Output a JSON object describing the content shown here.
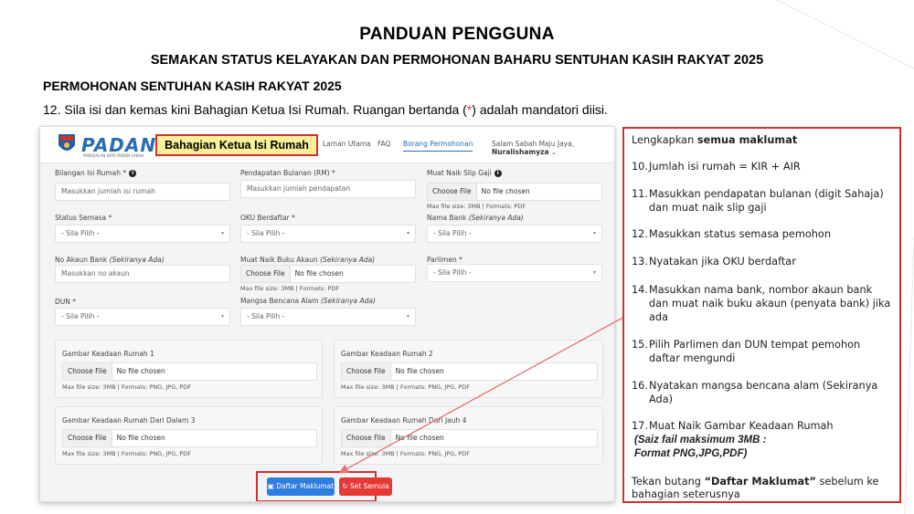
{
  "slide": {
    "title": "PANDUAN PENGGUNA",
    "subtitle": "SEMAKAN STATUS KELAYAKAN DAN PERMOHONAN BAHARU SENTUHAN  KASIH RAKYAT 2025",
    "section": "PERMOHONAN SENTUHAN  KASIH RAKYAT 2025",
    "instruction_pre": "12. Sila isi dan kemas kini Bahagian Ketua Isi Rumah. Ruangan bertanda (",
    "instruction_star": "*",
    "instruction_post": ") adalah mandatori diisi."
  },
  "app": {
    "brand": "PADANS",
    "brand_tagline": "PANGKALAN DATA MISKIN SABAH",
    "section_label": "Bahagian Ketua Isi Rumah",
    "nav": [
      "Laman Utama",
      "FAQ",
      "Borang Permohonan",
      "Salam Sabah Maju Jaya,"
    ],
    "username": "Nuralishamyza",
    "user_caret": "⌄"
  },
  "form": {
    "info_glyph": "i",
    "select_caret": "▾",
    "bilangan": {
      "label": "Bilangan Isi Rumah *",
      "placeholder": "Masukkan jumlah isi rumah"
    },
    "pendapatan": {
      "label": "Pendapatan Bulanan (RM) *",
      "placeholder": "Masukkan jumlah pendapatan"
    },
    "slip": {
      "label": "Muat Naik Slip Gaji",
      "choose": "Choose File",
      "nofile": "No file chosen",
      "hint": "Max file size: 3MB | Formats: PDF"
    },
    "status": {
      "label": "Status Semasa *",
      "value": "- Sila Pilih -"
    },
    "oku": {
      "label": "OKU Berdaftar *",
      "value": "- Sila Pilih -"
    },
    "bank": {
      "label": "Nama Bank",
      "label_opt": "(Sekiranya Ada)",
      "value": "- Sila Pilih -"
    },
    "akaun": {
      "label": "No Akaun Bank",
      "label_opt": "(Sekiranya Ada)",
      "placeholder": "Masukkan no akaun"
    },
    "buku": {
      "label": "Muat Naik Buku Akaun",
      "label_opt": "(Sekiranya Ada)",
      "choose": "Choose File",
      "nofile": "No file chosen",
      "hint": "Max file size: 3MB | Formats: PDF"
    },
    "parlimen": {
      "label": "Parlimen *",
      "value": "- Sila Pilih -"
    },
    "dun": {
      "label": "DUN *",
      "value": "- Sila Pilih -"
    },
    "bencana": {
      "label": "Mangsa Bencana Alam",
      "label_opt": "(Sekiranya Ada)",
      "value": "- Sila Pilih -"
    },
    "gambar": [
      {
        "title": "Gambar Keadaan Rumah 1",
        "choose": "Choose File",
        "nofile": "No file chosen",
        "hint": "Max file size: 3MB | Formats: PNG, JPG, PDF"
      },
      {
        "title": "Gambar Keadaan Rumah 2",
        "choose": "Choose File",
        "nofile": "No file chosen",
        "hint": "Max file size: 3MB | Formats: PNG, JPG, PDF"
      },
      {
        "title": "Gambar Keadaan Rumah Dari Dalam 3",
        "choose": "Choose File",
        "nofile": "No file chosen",
        "hint": "Max file size: 3MB | Formats: PNG, JPG, PDF"
      },
      {
        "title": "Gambar Keadaan Rumah Dari Jauh 4",
        "choose": "Choose File",
        "nofile": "No file chosen",
        "hint": "Max file size: 3MB | Formats: PNG, JPG, PDF"
      }
    ],
    "submit": "Daftar Maklumat",
    "reset": "Set Semula",
    "submit_icon": "▣",
    "reset_icon": "↻"
  },
  "guide": {
    "head_pre": "Lengkapkan ",
    "head_bold": "semua maklumat",
    "items": [
      {
        "n": "10.",
        "t": "Jumlah isi rumah = KIR + AIR"
      },
      {
        "n": "11.",
        "t": "Masukkan pendapatan bulanan (digit Sahaja) dan muat naik slip gaji"
      },
      {
        "n": "12.",
        "t": "Masukkan status semasa pemohon"
      },
      {
        "n": "13.",
        "t": "Nyatakan jika OKU berdaftar"
      },
      {
        "n": "14.",
        "t": "Masukkan nama bank, nombor akaun bank dan muat naik buku akaun (penyata bank) jika ada"
      },
      {
        "n": "15.",
        "t": "Pilih Parlimen dan DUN tempat pemohon daftar mengundi"
      },
      {
        "n": "16.",
        "t": "Nyatakan mangsa bencana alam (Sekiranya Ada)"
      },
      {
        "n": "17.",
        "t": "Muat Naik Gambar Keadaan Rumah"
      }
    ],
    "note1": "(Saiz fail maksimum 3MB :",
    "note2": "Format PNG,JPG,PDF)",
    "foot_pre": "Tekan butang ",
    "foot_bold": "“Daftar Maklumat”",
    "foot_post": " sebelum ke bahagian seterusnya"
  },
  "colors": {
    "accent_red": "#d32f2f",
    "primary_blue": "#2f7de1",
    "highlight_yellow": "#f7ef9a"
  }
}
